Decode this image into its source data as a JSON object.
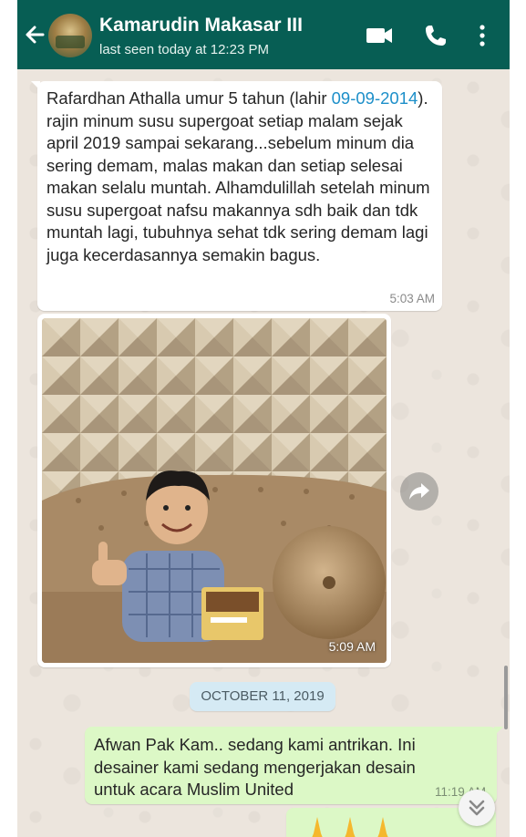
{
  "header": {
    "contact_name": "Kamarudin Makasar III",
    "last_seen": "last seen today at 12:23 PM",
    "bg_color": "#075e54"
  },
  "messages": [
    {
      "type": "text",
      "direction": "incoming",
      "text_before_date": "Rafardhan Athalla umur 5 tahun (lahir ",
      "date_link": "09-09-2014",
      "text_after_date": "). rajin minum susu supergoat setiap malam sejak april 2019 sampai sekarang...sebelum minum dia sering demam, malas makan dan setiap selesai makan selalu muntah. Alhamdulillah setelah minum susu supergoat nafsu makannya sdh baik dan tdk muntah lagi, tubuhnya sehat tdk sering demam lagi  juga kecerdasannya semakin bagus.",
      "time": "5:03 AM"
    },
    {
      "type": "image",
      "direction": "incoming",
      "image_alt": "child-on-sofa-holding-product-photo",
      "time": "5:09 AM"
    },
    {
      "type": "text",
      "direction": "outgoing",
      "text": "Afwan Pak Kam.. sedang kami antrikan. Ini desainer kami sedang mengerjakan desain untuk acara Muslim United",
      "time": "11:19 AM"
    },
    {
      "type": "emoji",
      "direction": "outgoing",
      "icons": [
        "folded-hands-icon",
        "folded-hands-icon",
        "folded-hands-icon"
      ]
    }
  ],
  "date_divider": "OCTOBER 11, 2019",
  "colors": {
    "incoming_bubble": "#ffffff",
    "outgoing_bubble": "#dcf8c6",
    "chat_bg": "#ece5dd",
    "link": "#1d8fc9"
  }
}
